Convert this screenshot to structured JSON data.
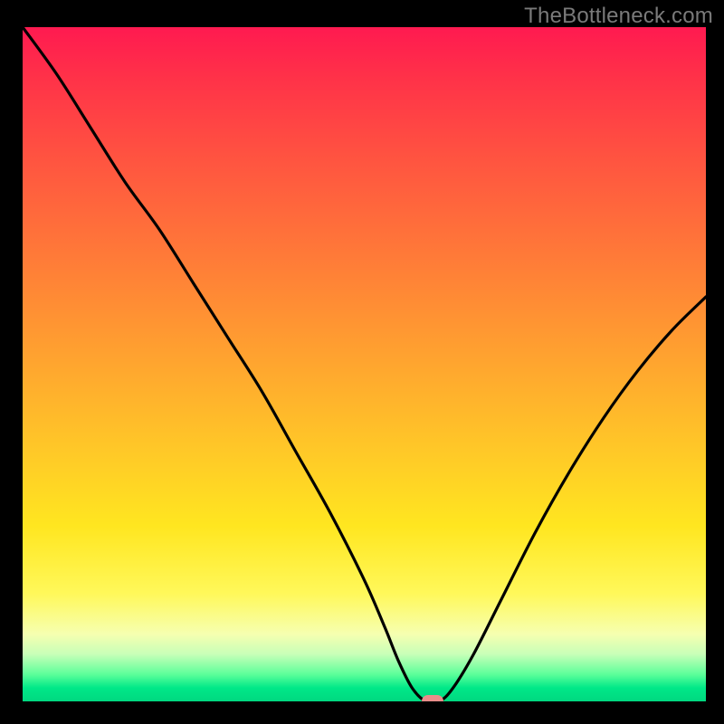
{
  "watermark": "TheBottleneck.com",
  "chart_data": {
    "type": "line",
    "title": "",
    "xlabel": "",
    "ylabel": "",
    "xlim": [
      0,
      100
    ],
    "ylim": [
      0,
      100
    ],
    "grid": false,
    "legend": false,
    "background_gradient": {
      "orientation": "vertical",
      "stops": [
        {
          "pct": 0,
          "color": "#ff1a50"
        },
        {
          "pct": 20,
          "color": "#ff5540"
        },
        {
          "pct": 48,
          "color": "#ffa030"
        },
        {
          "pct": 74,
          "color": "#ffe620"
        },
        {
          "pct": 90,
          "color": "#f6ffb0"
        },
        {
          "pct": 100,
          "color": "#00d880"
        }
      ]
    },
    "series": [
      {
        "name": "bottleneck-curve",
        "color": "#000000",
        "x": [
          0,
          5,
          10,
          15,
          20,
          25,
          30,
          35,
          40,
          45,
          50,
          53,
          55,
          57,
          59,
          61,
          63,
          66,
          70,
          75,
          80,
          85,
          90,
          95,
          100
        ],
        "y": [
          100,
          93,
          85,
          77,
          70,
          62,
          54,
          46,
          37,
          28,
          18,
          11,
          6,
          2,
          0,
          0,
          2,
          7,
          15,
          25,
          34,
          42,
          49,
          55,
          60
        ]
      }
    ],
    "marker_point": {
      "x": 60,
      "y": 0,
      "color": "#e98d8a"
    },
    "annotations": []
  },
  "icon_names": {
    "watermark": "watermark-text"
  }
}
